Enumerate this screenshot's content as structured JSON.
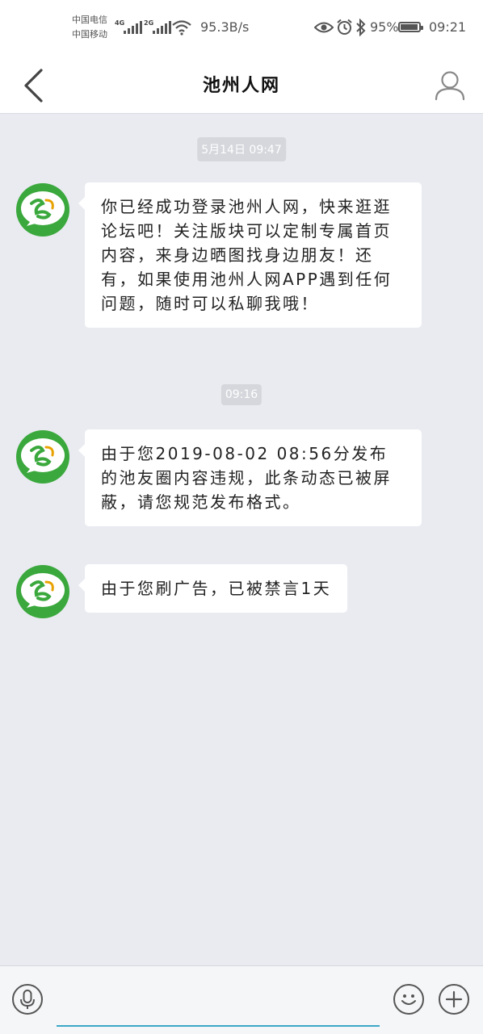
{
  "status_bar": {
    "carrier_1": "中国电信",
    "carrier_2": "中国移动",
    "network_1": "4G",
    "network_2": "2G",
    "speed": "95.3B/s",
    "battery_percent": "95%",
    "battery_level": 0.95,
    "time": "09:21"
  },
  "header": {
    "title": "池州人网",
    "back_icon": "chevron-left-icon",
    "profile_icon": "user-icon"
  },
  "messages": [
    {
      "timestamp": "5月14日 09:47",
      "text": "你已经成功登录池州人网，快来逛逛论坛吧！关注版块可以定制专属首页内容，来身边晒图找身边朋友！还有，如果使用池州人网APP遇到任何问题，随时可以私聊我哦！"
    },
    {
      "timestamp": "09:16",
      "text": "由于您2019-08-02 08:56分发布的池友圈内容违规，此条动态已被屏蔽，请您规范发布格式。"
    },
    {
      "timestamp": "",
      "text": "由于您刷广告，已被禁言1天"
    }
  ],
  "input_bar": {
    "voice_icon": "microphone-icon",
    "emoji_icon": "smiley-icon",
    "plus_icon": "plus-icon",
    "input_value": ""
  },
  "colors": {
    "background": "#e9ebf0",
    "avatar_green": "#3aa83c",
    "input_underline": "#3aa7c7"
  }
}
